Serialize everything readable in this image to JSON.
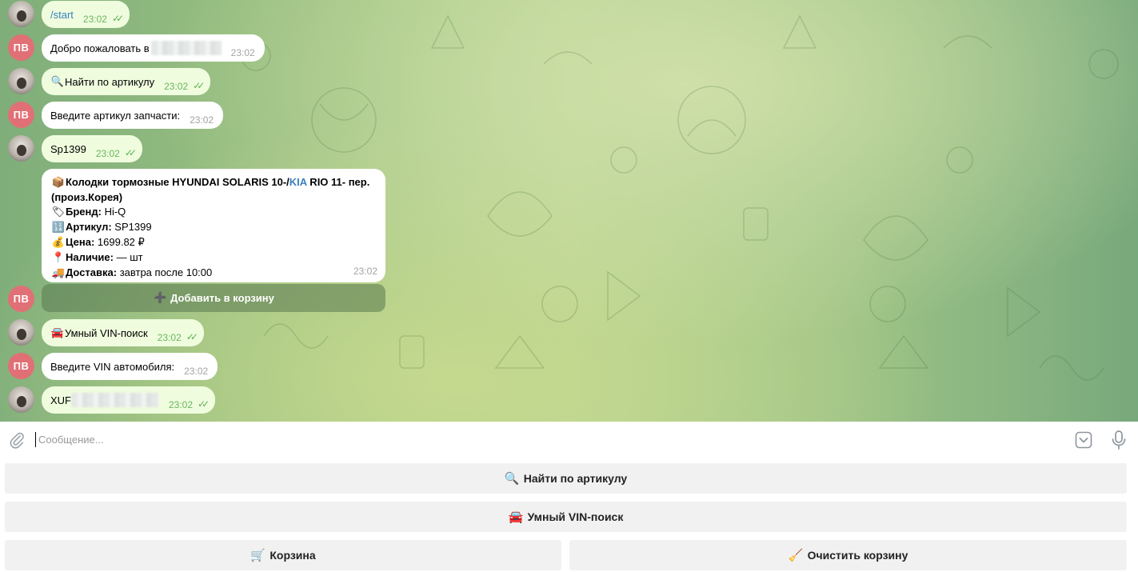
{
  "messages": [
    {
      "text": "/start",
      "time": "23:02",
      "author": "user"
    },
    {
      "text": "Добро пожаловать в",
      "time": "23:02",
      "author": "bot",
      "avatar_initials": "ПВ"
    },
    {
      "icon": "🔍",
      "text": "Найти по артикулу",
      "time": "23:02",
      "author": "user"
    },
    {
      "text": "Введите артикул запчасти:",
      "time": "23:02",
      "author": "bot",
      "avatar_initials": "ПВ"
    },
    {
      "text": "Sp1399",
      "time": "23:02",
      "author": "user"
    },
    {
      "text": "Умный VIN-поиск",
      "icon": "🚘",
      "time": "23:02",
      "author": "user"
    },
    {
      "text": "Введите VIN автомобиля:",
      "time": "23:02",
      "author": "bot",
      "avatar_initials": "ПВ"
    },
    {
      "text": "XUF",
      "time": "23:02",
      "author": "user"
    }
  ],
  "product_card": {
    "author": "bot",
    "avatar_initials": "ПВ",
    "title_part1": "Колодки тормозные HYUNDAI SOLARIS 10-/",
    "title_link": "KIA",
    "title_part2": " RIO 11- пер.",
    "title_line2": "(произ.Корея)",
    "brand_label": "Бренд:",
    "brand_value": " Hi-Q",
    "article_label": "Артикул:",
    "article_value": " SP1399",
    "price_label": "Цена:",
    "price_value": " 1699.82 ₽",
    "stock_label": "Наличие:",
    "stock_value": " — шт",
    "delivery_label": "Доставка:",
    "delivery_value": " завтра после 10:00",
    "time": "23:02",
    "icons": {
      "title": "📦",
      "brand": "🏷",
      "article": "🔢",
      "price": "💰",
      "stock": "📍",
      "delivery": "🚚"
    }
  },
  "inline_button": {
    "icon": "➕",
    "label": "Добавить в корзину"
  },
  "composer": {
    "placeholder": "Сообщение..."
  },
  "keyboard": [
    {
      "icon": "🔍",
      "label": "Найти по артикулу"
    },
    {
      "icon": "🚘",
      "label": "Умный VIN-поиск"
    },
    {
      "icon": "🛒",
      "label": "Корзина"
    },
    {
      "icon": "🧹",
      "label": "Очистить корзину"
    }
  ],
  "colors": {
    "outgoing_bubble": "#effdde",
    "incoming_bubble": "#ffffff",
    "bot_avatar": "#e17076",
    "link": "#3a7fc1",
    "check": "#5fb053"
  }
}
